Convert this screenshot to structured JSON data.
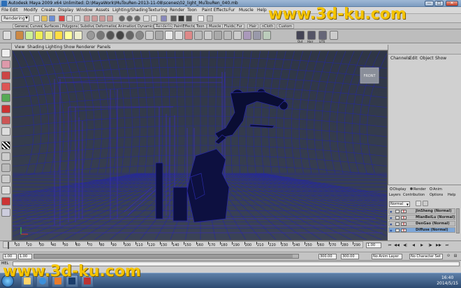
{
  "window": {
    "title": "Autodesk Maya 2009 x64 Unlimited: D:\\MayaWork\\MuTouRen-2013-11-08\\scenes\\02_light_MuTouRen_040.mb",
    "buttons": [
      "—",
      "□",
      "✕"
    ]
  },
  "menubar": [
    "File",
    "Edit",
    "Modify",
    "Create",
    "Display",
    "Window",
    "Assets",
    "Lighting/Shading",
    "Texturing",
    "Render",
    "Toon",
    "Paint Effects",
    "Fur",
    "Muscle",
    "Help"
  ],
  "status_line": {
    "mode": "Rendering"
  },
  "shelf_tabs": [
    "General",
    "Curves",
    "Surfaces",
    "Polygons",
    "Subdivs",
    "Deformation",
    "Animation",
    "Dynamics",
    "Rendering",
    "PaintEffects",
    "Toon",
    "Muscle",
    "Fluids",
    "Fur",
    "Hair",
    "nCloth",
    "Custom"
  ],
  "shelf_active_tab": "Rendering",
  "shelf_icon_labels": [
    "Out",
    "Hair",
    "LITE"
  ],
  "panel_menu": [
    "View",
    "Shading",
    "Lighting",
    "Show",
    "Renderer",
    "Panels"
  ],
  "viewport": {
    "view_cube_label": "FRONT"
  },
  "channel_box": {
    "menu": [
      "Channels",
      "Edit",
      "Object",
      "Show"
    ]
  },
  "layer_editor": {
    "modes": [
      "Display",
      "Render",
      "Anim"
    ],
    "selected_mode": "Render",
    "menu": [
      "Layers",
      "Contribution",
      "Options",
      "Help"
    ],
    "blend_mode": "Normal",
    "layers": [
      {
        "name": "JinSheng (Normal)",
        "selected": false
      },
      {
        "name": "MianBeiLu (Normal)",
        "selected": false
      },
      {
        "name": "DenGao (Normal)",
        "selected": false
      },
      {
        "name": "Diffuse (Normal)",
        "selected": true
      }
    ]
  },
  "time_slider": {
    "ticks": [
      "10",
      "20",
      "30",
      "40",
      "50",
      "60",
      "70",
      "80",
      "90",
      "100",
      "110",
      "120",
      "130",
      "140",
      "150",
      "160",
      "170",
      "180",
      "190",
      "200",
      "210",
      "220",
      "230",
      "240",
      "250",
      "260",
      "270",
      "280",
      "290"
    ],
    "current_frame": "1.00"
  },
  "range_slider": {
    "start": "1.00",
    "inner_start": "1.00",
    "inner_end": "300.00",
    "end": "300.00",
    "anim_layer": "No Anim Layer",
    "character_set": "No Character Set"
  },
  "command_line": {
    "label": "MEL"
  },
  "taskbar": {
    "time": "16:40",
    "date": "2014/5/15"
  },
  "watermarks": [
    "www.3d-ku.com",
    "www.3d-ku.com"
  ],
  "colors": {
    "viewport_bg": "#2c3341",
    "wire": "#1a1aa8",
    "silhouette": "#0b0f3a",
    "watermark": "#f5c400"
  }
}
